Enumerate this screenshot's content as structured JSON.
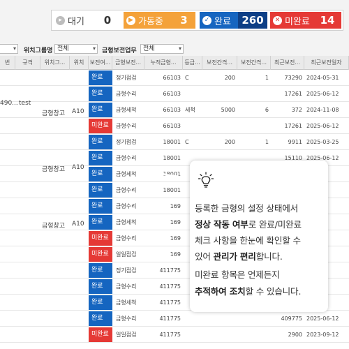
{
  "status": {
    "waiting": {
      "label": "대기",
      "count": "0",
      "color": "#9e9e9e"
    },
    "running": {
      "label": "가동중",
      "count": "3",
      "color": "#f4a23a"
    },
    "done": {
      "label": "완료",
      "count": "260",
      "color": "#1565c0"
    },
    "undone": {
      "label": "미완료",
      "count": "14",
      "color": "#e53935"
    }
  },
  "filters": {
    "group_label": "위치그룹명",
    "group_value": "전체",
    "task_label": "금형보전업무",
    "task_value": "전체"
  },
  "headers": [
    "번",
    "규격",
    "위치그...",
    "위치",
    "보전여...",
    "금형보전...",
    "누적금형...",
    "등급...",
    "보전간격...",
    "보전간격...",
    "최근보전...",
    "최근보전일자"
  ],
  "rows": [
    {
      "status": "완료",
      "task": "정기점검",
      "cum": "66103",
      "grade": "C",
      "iv1": "200",
      "iv2": "1",
      "recent": "73290",
      "date": "2024-05-31"
    },
    {
      "status": "완료",
      "task": "금형수리",
      "cum": "66103",
      "grade": "",
      "iv1": "",
      "iv2": "",
      "recent": "17261",
      "date": "2025-06-12"
    },
    {
      "status": "완료",
      "task": "금형세척",
      "cum": "66103",
      "grade": "세척",
      "iv1": "5000",
      "iv2": "6",
      "recent": "372",
      "date": "2024-11-08"
    },
    {
      "status": "미완료",
      "task": "금형수리",
      "cum": "66103",
      "grade": "",
      "iv1": "",
      "iv2": "",
      "recent": "17261",
      "date": "2025-06-12"
    },
    {
      "status": "완료",
      "task": "정기점검",
      "cum": "18001",
      "grade": "C",
      "iv1": "200",
      "iv2": "1",
      "recent": "9911",
      "date": "2025-03-25"
    },
    {
      "status": "완료",
      "task": "금형수리",
      "cum": "18001",
      "grade": "",
      "iv1": "",
      "iv2": "",
      "recent": "15110",
      "date": "2025-06-12"
    },
    {
      "status": "완료",
      "task": "금형세척",
      "cum": "18001",
      "grade": "",
      "iv1": "",
      "iv2": "",
      "recent": "",
      "date": ""
    },
    {
      "status": "완료",
      "task": "금형수리",
      "cum": "18001",
      "grade": "",
      "iv1": "",
      "iv2": "",
      "recent": "",
      "date": ""
    },
    {
      "status": "완료",
      "task": "금형수리",
      "cum": "169",
      "grade": "",
      "iv1": "",
      "iv2": "",
      "recent": "",
      "date": ""
    },
    {
      "status": "완료",
      "task": "금형세척",
      "cum": "169",
      "grade": "",
      "iv1": "",
      "iv2": "",
      "recent": "",
      "date": ""
    },
    {
      "status": "미완료",
      "task": "금형수리",
      "cum": "169",
      "grade": "",
      "iv1": "",
      "iv2": "",
      "recent": "",
      "date": ""
    },
    {
      "status": "미완료",
      "task": "일일점검",
      "cum": "169",
      "grade": "",
      "iv1": "",
      "iv2": "",
      "recent": "",
      "date": ""
    },
    {
      "status": "완료",
      "task": "정기점검",
      "cum": "411775",
      "grade": "",
      "iv1": "",
      "iv2": "",
      "recent": "",
      "date": ""
    },
    {
      "status": "완료",
      "task": "금형수리",
      "cum": "411775",
      "grade": "",
      "iv1": "",
      "iv2": "",
      "recent": "",
      "date": ""
    },
    {
      "status": "완료",
      "task": "금형세척",
      "cum": "411775",
      "grade": "",
      "iv1": "",
      "iv2": "",
      "recent": "",
      "date": ""
    },
    {
      "status": "완료",
      "task": "금형수리",
      "cum": "411775",
      "grade": "",
      "iv1": "",
      "iv2": "",
      "recent": "409775",
      "date": "2025-06-12"
    },
    {
      "status": "미완료",
      "task": "일일점검",
      "cum": "411775",
      "grade": "",
      "iv1": "",
      "iv2": "",
      "recent": "2900",
      "date": "2023-09-12"
    }
  ],
  "groups": [
    {
      "no": "490...",
      "spec": "test",
      "name": "금형창고",
      "loc": "A10"
    },
    {
      "no": "",
      "spec": "",
      "name": "금형창고",
      "loc": "A10"
    },
    {
      "no": "",
      "spec": "",
      "name": "금형창고",
      "loc": "A10"
    }
  ],
  "callout": {
    "icon": "lightbulb-icon",
    "line1": "등록한 금형의 설정 상태에서",
    "line2_bold": "정상 작동 여부",
    "line2_rest": "로 완료/미완료",
    "line3": "체크 사항을 한눈에 확인할 수",
    "line4_pre": "있어 ",
    "line4_bold": "관리가 편리",
    "line4_rest": "합니다.",
    "line5": "미완료 항목은 언제든지",
    "line6_bold": "추적하여 조치",
    "line6_rest": "할 수 있습니다."
  },
  "colors": {
    "done": "#1565c0",
    "undone": "#e53935",
    "accent_line": "#ffffff"
  }
}
